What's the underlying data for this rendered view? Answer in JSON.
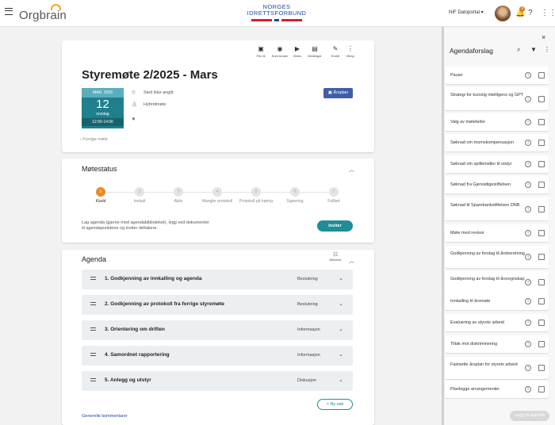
{
  "header": {
    "logo": "Orgbrain",
    "nif_line1": "NORGES",
    "nif_line2": "IDRETTSFORBUND",
    "portal": "NIF Datoportal",
    "notif_count": "9",
    "icons": [
      "menu-icon",
      "bell-icon",
      "help-icon",
      "apps-icon"
    ]
  },
  "toolbar": [
    {
      "icon": "calendar-icon",
      "label": "Feri til"
    },
    {
      "icon": "eye-icon",
      "label": "Som bruker"
    },
    {
      "icon": "video-icon",
      "label": "Video"
    },
    {
      "icon": "chat-icon",
      "label": "Meldinger"
    },
    {
      "icon": "pencil-icon",
      "label": "Endre"
    },
    {
      "icon": "dots-icon",
      "label": "Meny"
    }
  ],
  "meeting": {
    "title": "Styremøte 2/2025 - Mars",
    "month": "MAR. 2025",
    "day": "12",
    "weekday": "onsdag",
    "time": "12:00-14:00",
    "location": "Sted ikke angitt",
    "mode": "Hybridmøte",
    "arsplan": "Årsplan",
    "prev": "Forrige møte"
  },
  "status": {
    "title": "Møtestatus",
    "steps": [
      {
        "n": "1",
        "label": "Kladd"
      },
      {
        "n": "2",
        "label": "Innkalt"
      },
      {
        "n": "3",
        "label": "Aktiv"
      },
      {
        "n": "4",
        "label": "Mangler protokoll"
      },
      {
        "n": "5",
        "label": "Protokoll på høring"
      },
      {
        "n": "6",
        "label": "Signering"
      },
      {
        "n": "7",
        "label": "Fullført"
      }
    ],
    "active": 0,
    "info1": "Lag agenda (gjerne med agendabiblioteket), legg ved dokumenter",
    "info2": "til agendapunktene og inviter deltakere.",
    "invite": "Inviter"
  },
  "agenda": {
    "title": "Agenda",
    "view_label": "Bibliotek",
    "items": [
      {
        "label": "1. Godkjenning av innkalling og agenda",
        "type": "Beslutning"
      },
      {
        "label": "2. Godkjenning av protokoll fra forrige styremøte",
        "type": "Beslutning"
      },
      {
        "label": "3. Orientering om driften",
        "type": "Informasjon"
      },
      {
        "label": "4. Samordnet rapportering",
        "type": "Informasjon"
      },
      {
        "label": "5. Anlegg og utstyr",
        "type": "Diskusjon"
      }
    ],
    "new_item": "+ Ny sak",
    "general": "Generelle kommentarer"
  },
  "panel": {
    "title": "Agendaforslag",
    "items": [
      "Pause",
      "Strategi for kunstig intelligens og GPT",
      "Valg av møteleder",
      "Søknad om momskompensasjon",
      "Søknad om spillemidler til utstyr",
      "Søknad fra Gjensidigestiftelsen",
      "Søknad til Sparebankstiftelsen DNB",
      "Møte med revisor",
      "Godkjenning av forslag til årsberetning",
      "Godkjenning av forslag til årsregnskap",
      "Innkalling til årsmøte",
      "Evaluering av styrets arbeid",
      "Tiltak mot diskriminering",
      "Fastsette årsplan for styrets arbeid",
      "Planlegge arrangementer"
    ],
    "add": "Legg til agenda"
  }
}
